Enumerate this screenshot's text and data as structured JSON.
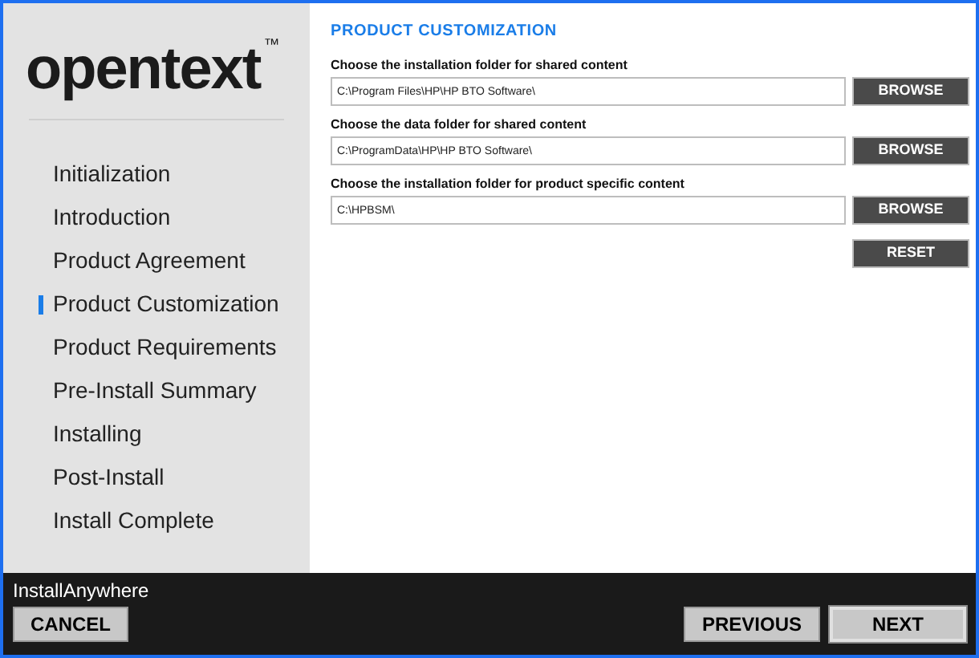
{
  "logo": {
    "text": "opentext",
    "mark": "™"
  },
  "steps": [
    {
      "label": "Initialization",
      "selected": false
    },
    {
      "label": "Introduction",
      "selected": false
    },
    {
      "label": "Product Agreement",
      "selected": false
    },
    {
      "label": "Product Customization",
      "selected": true
    },
    {
      "label": "Product Requirements",
      "selected": false
    },
    {
      "label": "Pre-Install Summary",
      "selected": false
    },
    {
      "label": "Installing",
      "selected": false
    },
    {
      "label": "Post-Install",
      "selected": false
    },
    {
      "label": "Install Complete",
      "selected": false
    }
  ],
  "heading": "PRODUCT CUSTOMIZATION",
  "folders": [
    {
      "label": "Choose the installation folder for shared content",
      "value": "C:\\Program Files\\HP\\HP BTO Software\\",
      "button": "BROWSE"
    },
    {
      "label": "Choose the data folder for shared content",
      "value": "C:\\ProgramData\\HP\\HP BTO Software\\",
      "button": "BROWSE"
    },
    {
      "label": "Choose the installation folder for product specific content",
      "value": "C:\\HPBSM\\",
      "button": "BROWSE"
    }
  ],
  "reset_button": "RESET",
  "footer": {
    "brand": "InstallAnywhere",
    "cancel": "CANCEL",
    "previous": "PREVIOUS",
    "next": "NEXT"
  }
}
